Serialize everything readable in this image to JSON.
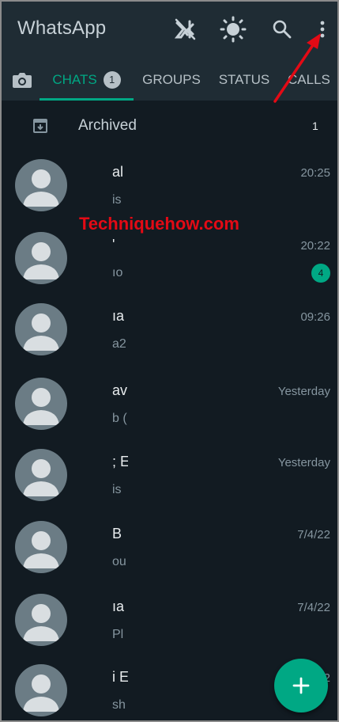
{
  "app": {
    "title": "WhatsApp"
  },
  "toolbar": {
    "icons": [
      "camera-off-icon",
      "brightness-icon",
      "search-icon",
      "more-vert-icon"
    ]
  },
  "tabs": [
    {
      "label": "",
      "icon": "camera-icon"
    },
    {
      "label": "CHATS",
      "badge": "1",
      "active": true
    },
    {
      "label": "GROUPS"
    },
    {
      "label": "STATUS"
    },
    {
      "label": "CALLS"
    }
  ],
  "archived": {
    "label": "Archived",
    "count": "1"
  },
  "watermark": "Techniquehow.com",
  "chats": [
    {
      "name": "al",
      "preview": "is",
      "time": "20:25",
      "unread": ""
    },
    {
      "name": "'",
      "preview": "ıo",
      "time": "20:22",
      "unread": "4"
    },
    {
      "name": "ıa",
      "preview": "a2",
      "time": "09:26",
      "unread": ""
    },
    {
      "name": "av",
      "preview": "b (",
      "time": "Yesterday",
      "unread": ""
    },
    {
      "name": "; E",
      "preview": "is",
      "time": "Yesterday",
      "unread": ""
    },
    {
      "name": "B",
      "preview": "ou",
      "time": "7/4/22",
      "unread": ""
    },
    {
      "name": "ıa",
      "preview": "Pl",
      "time": "7/4/22",
      "unread": ""
    },
    {
      "name": "i E",
      "preview": "sh",
      "time": "7/4/22",
      "unread": ""
    }
  ],
  "colors": {
    "appbar": "#1f2c34",
    "background": "#121b22",
    "accent": "#00a884",
    "arrow": "#e30a15"
  }
}
